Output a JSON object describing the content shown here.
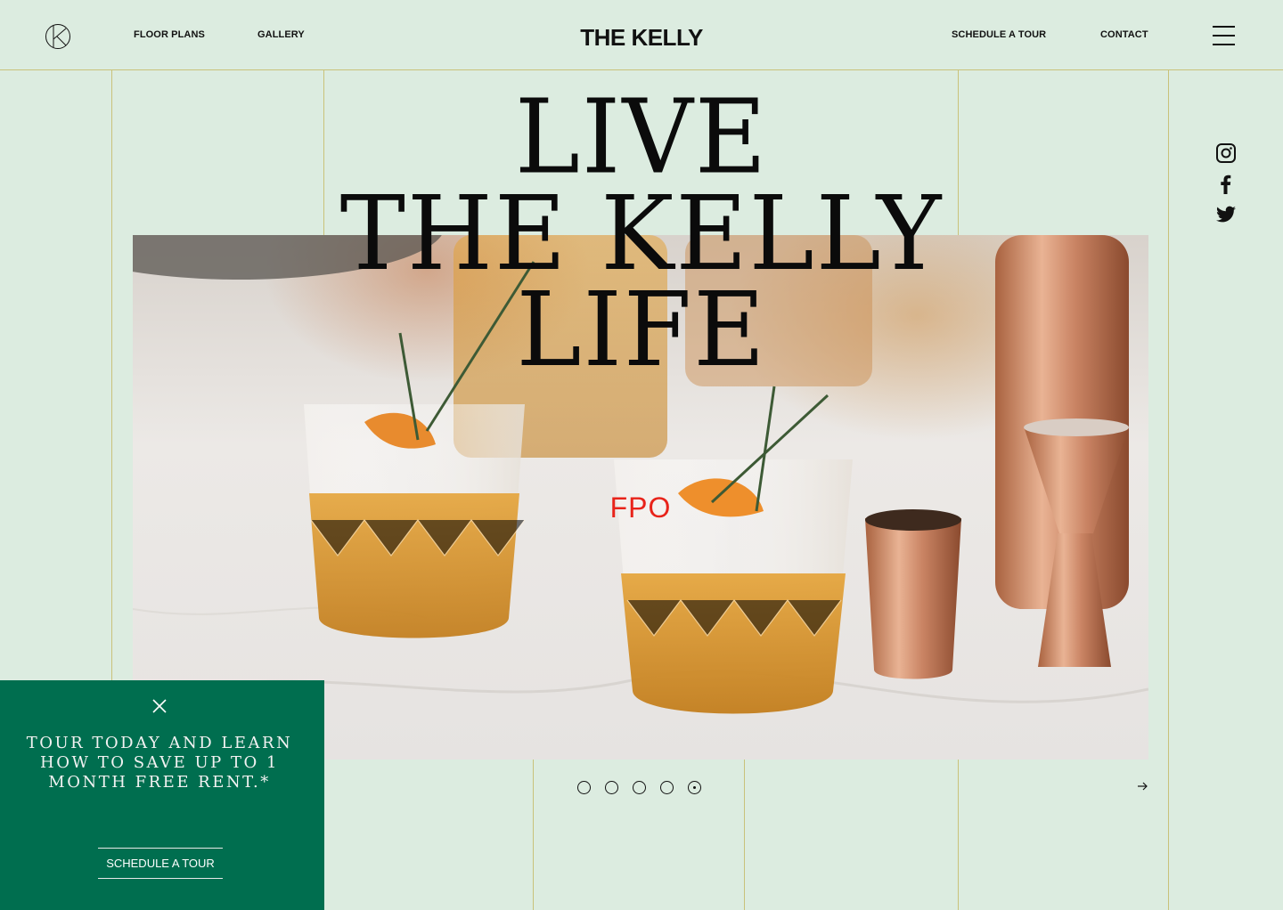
{
  "header": {
    "logo_icon": "k-monogram-logo-icon",
    "brand": "THE KELLY",
    "nav_left": [
      "FLOOR PLANS",
      "GALLERY"
    ],
    "nav_right": [
      "SCHEDULE A TOUR",
      "CONTACT"
    ],
    "menu_icon": "hamburger-menu-icon"
  },
  "hero": {
    "headline_lines": [
      "LIVE",
      "THE KELLY",
      "LIFE"
    ],
    "placeholder_label": "FPO",
    "image_subject": "cocktail-glasses-photo"
  },
  "social": [
    "instagram-icon",
    "facebook-icon",
    "twitter-icon"
  ],
  "carousel": {
    "slide_count": 5,
    "active_index": 4,
    "next_icon": "arrow-right-icon"
  },
  "promo": {
    "close_icon": "close-icon",
    "text": "Tour today and learn how to save up to 1 month free rent.*",
    "cta_label": "SCHEDULE A TOUR",
    "background": "#006e4f"
  },
  "colors": {
    "page_background": "#dcece0",
    "grid_lines": "#c9c27a",
    "placeholder_text": "#e8231a"
  }
}
